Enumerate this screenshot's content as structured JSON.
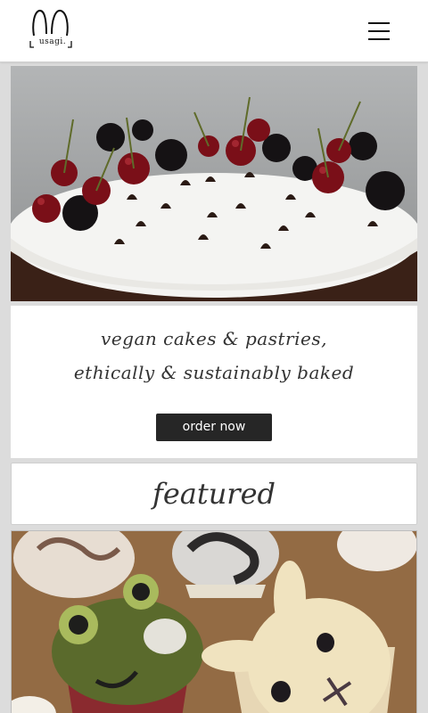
{
  "header": {
    "logo_text": "usagi.",
    "menu_icon": "hamburger-menu-icon"
  },
  "hero": {
    "image": "vegan chocolate cake topped with cherries, blackberries and chocolate chips"
  },
  "tagline": {
    "line1": "vegan cakes & pastries,",
    "line2": "ethically & sustainably baked",
    "button_label": "order now"
  },
  "featured": {
    "title": "featured",
    "image": "frog and bunny decorated cupcakes"
  },
  "colors": {
    "page_background": "#dcdcdc",
    "card_background": "#ffffff",
    "button_background": "#262626",
    "button_text": "#ffffff",
    "script_text": "#333333"
  }
}
